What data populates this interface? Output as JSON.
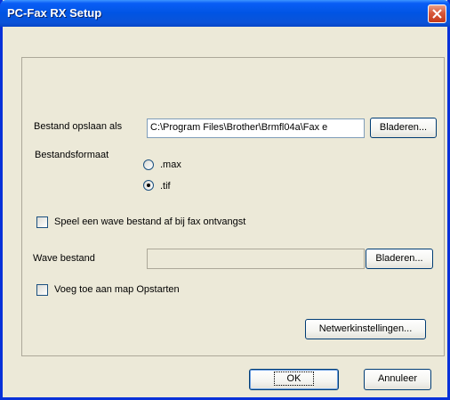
{
  "window": {
    "title": "PC-Fax RX Setup"
  },
  "file": {
    "save_as_label": "Bestand opslaan als",
    "path_value": "C:\\Program Files\\Brother\\Brmfl04a\\Fax e",
    "browse_label": "Bladeren..."
  },
  "format": {
    "label": "Bestandsformaat",
    "options": [
      {
        "label": ".max",
        "checked": false
      },
      {
        "label": ".tif",
        "checked": true
      }
    ]
  },
  "wave": {
    "play_checkbox_label": "Speel een wave bestand af bij fax ontvangst",
    "play_checked": false,
    "file_label": "Wave bestand",
    "file_value": "",
    "browse_label": "Bladeren..."
  },
  "startup": {
    "checkbox_label": "Voeg toe aan map Opstarten",
    "checked": false
  },
  "network_button_label": "Netwerkinstellingen...",
  "footer": {
    "ok_label": "OK",
    "cancel_label": "Annuleer"
  }
}
